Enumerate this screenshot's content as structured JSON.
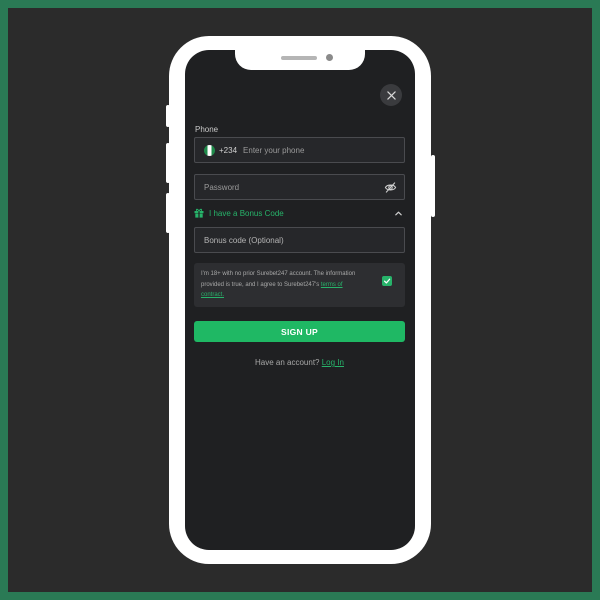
{
  "form": {
    "phone_label": "Phone",
    "country_code": "+234",
    "phone_placeholder": "Enter your phone",
    "password_placeholder": "Password",
    "bonus_toggle_label": "I have a Bonus Code",
    "bonus_placeholder": "Bonus code (Optional)",
    "consent_text": "I'm 18+ with no prior Surebet247 account. The information provided is true, and I agree to Surebet247's ",
    "consent_link": "terms of contract.",
    "consent_checked": true,
    "signup_label": "SIGN UP",
    "have_account_text": "Have an account? ",
    "login_link": "Log In"
  },
  "icons": {
    "close": "close-icon",
    "eye": "eye-off-icon",
    "gift": "gift-icon",
    "chevron": "chevron-up-icon",
    "check": "check-icon",
    "flag": "nigeria-flag-icon"
  },
  "colors": {
    "accent": "#27b36a",
    "button": "#1fb864",
    "screen_bg": "#1f2022",
    "outer_border": "#2a7a55"
  }
}
